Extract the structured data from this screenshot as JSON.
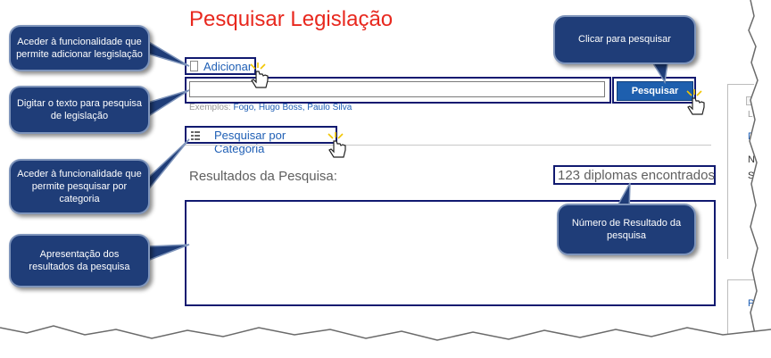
{
  "page": {
    "title": "Pesquisar Legislação"
  },
  "actions": {
    "add_label": "Adicionar"
  },
  "search": {
    "input_value": "",
    "button_label": "Pesquisar",
    "examples_prefix": "Exemplos: ",
    "examples": "Fogo, Hugo Boss, Paulo Silva"
  },
  "category": {
    "link_label": "Pesquisar por Categoria"
  },
  "results": {
    "label": "Resultados da Pesquisa:",
    "count_text": "123 diplomas encontrados"
  },
  "right_panel": {
    "text_le": "Le",
    "link_d": "D",
    "dark_n": "N",
    "dark_s": "S",
    "link_p": "P"
  },
  "callouts": {
    "add": "Aceder à funcionalidade que permite adicionar lesgislação",
    "search_text": "Digitar o texto para pesquisa de legislação",
    "category": "Aceder à funcionalidade que permite pesquisar por categoria",
    "results": "Apresentação dos resultados da pesquisa",
    "search_button": "Clicar para pesquisar",
    "count": "Número de Resultado da pesquisa"
  },
  "colors": {
    "title": "#e8281e",
    "link": "#1f5fb5",
    "button": "#1e5fae",
    "callout_bg": "#1f3d78",
    "highlight_border": "#111a70"
  },
  "icons": [
    "document-icon",
    "list-icon",
    "hand-cursor-icon",
    "panel-icon"
  ]
}
